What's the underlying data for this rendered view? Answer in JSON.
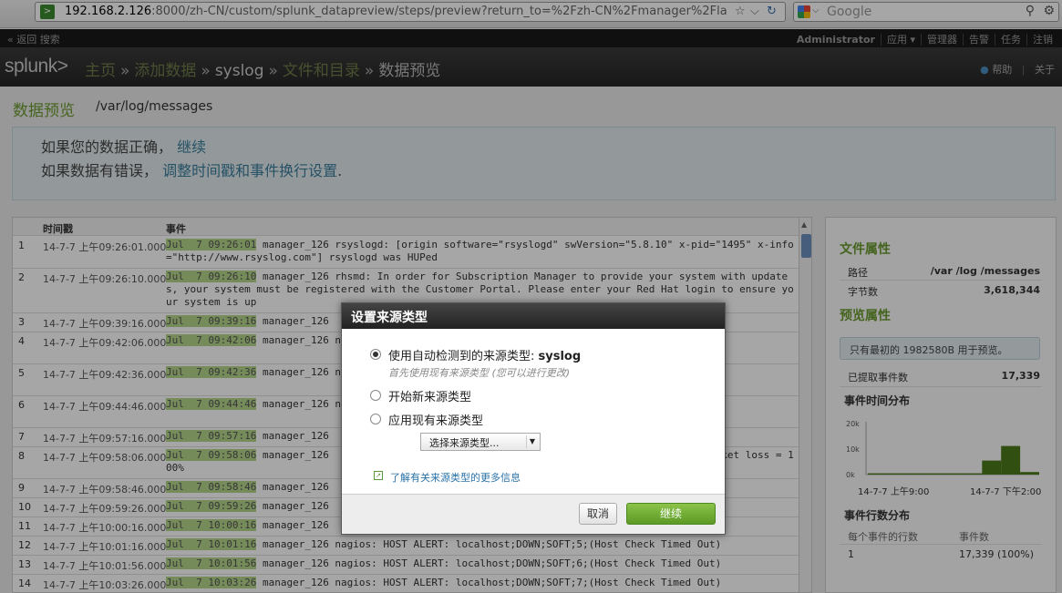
{
  "browser": {
    "url_host": "192.168.2.126",
    "url_rest": ":8000/zh-CN/custom/splunk_datapreview/steps/preview?return_to=%2Fzh-CN%2Fmanager%2Fla",
    "search_placeholder": "Google"
  },
  "topnav": {
    "back": "« 返回 搜索",
    "items": [
      "Administrator",
      "应用 ▾",
      "管理器",
      "告警",
      "任务",
      "注销"
    ]
  },
  "header": {
    "logo": "splunk>",
    "crumbs": [
      "主页",
      "添加数据",
      "syslog",
      "文件和目录"
    ],
    "current": "数据预览",
    "help": "帮助",
    "about": "关于"
  },
  "page": {
    "title": "数据预览",
    "path": "/var/log/messages",
    "info1_prefix": "如果您的数据正确，",
    "info1_link": "继续",
    "info2_prefix": "如果数据有错误，",
    "info2_link": "调整时间戳和事件换行设置",
    "info2_suffix": "."
  },
  "table": {
    "col_time": "时间戳",
    "col_event": "事件",
    "rows": [
      {
        "n": "1",
        "t": "14-7-7 上午09:26:01.000",
        "hl": "Jul  7 09:26:01",
        "text": " manager_126 rsyslogd: [origin software=\"rsyslogd\" swVersion=\"5.8.10\" x-pid=\"1495\" x-info=\"http://www.rsyslog.com\"] rsyslogd was HUPed"
      },
      {
        "n": "2",
        "t": "14-7-7 上午09:26:10.000",
        "hl": "Jul  7 09:26:10",
        "text": " manager_126 rhsmd: In order for Subscription Manager to provide your system with updates, your system must be registered with the Customer Portal. Please enter your Red Hat login to ensure your system is up"
      },
      {
        "n": "3",
        "t": "14-7-7 上午09:39:16.000",
        "hl": "Jul  7 09:39:16",
        "text": " manager_126"
      },
      {
        "n": "4",
        "t": "14-7-7 上午09:42:06.000",
        "hl": "Jul  7 09:42:06",
        "text": " manager_126 nagiosadmin;localhost;HTTP;C"
      },
      {
        "n": "5",
        "t": "14-7-7 上午09:42:36.000",
        "hl": "Jul  7 09:42:36",
        "text": " manager_126 nagiosadmin;localhost;Vsftp"
      },
      {
        "n": "6",
        "t": "14-7-7 上午09:44:46.000",
        "hl": "Jul  7 09:44:46",
        "text": " manager_126 nagiosadmin;localhost;SSH;C"
      },
      {
        "n": "7",
        "t": "14-7-7 上午09:57:16.000",
        "hl": "Jul  7 09:57:16",
        "text": " manager_126                                                    Out)"
      },
      {
        "n": "8",
        "t": "14-7-7 上午09:58:06.000",
        "hl": "Jul  7 09:58:06",
        "text": " manager_126                                                    RITICAL - Packet loss = 100%"
      },
      {
        "n": "9",
        "t": "14-7-7 上午09:58:46.000",
        "hl": "Jul  7 09:58:46",
        "text": " manager_126                                                    Out)"
      },
      {
        "n": "10",
        "t": "14-7-7 上午09:59:26.000",
        "hl": "Jul  7 09:59:26",
        "text": " manager_126                                                    Out)"
      },
      {
        "n": "11",
        "t": "14-7-7 上午10:00:16.000",
        "hl": "Jul  7 10:00:16",
        "text": " manager_126                                                    Out)"
      },
      {
        "n": "12",
        "t": "14-7-7 上午10:01:16.000",
        "hl": "Jul  7 10:01:16",
        "text": " manager_126 nagios: HOST ALERT: localhost;DOWN;SOFT;5;(Host Check Timed Out)"
      },
      {
        "n": "13",
        "t": "14-7-7 上午10:01:56.000",
        "hl": "Jul  7 10:01:56",
        "text": " manager_126 nagios: HOST ALERT: localhost;DOWN;SOFT;6;(Host Check Timed Out)"
      },
      {
        "n": "14",
        "t": "14-7-7 上午10:03:26.000",
        "hl": "Jul  7 10:03:26",
        "text": " manager_126 nagios: HOST ALERT: localhost;DOWN;SOFT;7;(Host Check Timed Out)"
      }
    ]
  },
  "sidebar": {
    "file_props": "文件属性",
    "path_k": "路径",
    "path_v": "/var /log /messages",
    "bytes_k": "字节数",
    "bytes_v": "3,618,344",
    "preview_props": "预览属性",
    "notice": "只有最初的 1982580B 用于预览。",
    "extracted_k": "已提取事件数",
    "extracted_v": "17,339",
    "time_dist": "事件时间分布",
    "y_ticks": [
      "20k",
      "10k",
      "0k"
    ],
    "x_ticks": [
      "14-7-7 上午9:00",
      "14-7-7 下午2:00"
    ],
    "line_dist": "事件行数分布",
    "lines_per_event_k": "每个事件的行数",
    "event_count_k": "事件数",
    "lines_row_k": "1",
    "lines_row_v": "17,339 (100%)"
  },
  "chart_data": {
    "type": "bar",
    "ylim": [
      0,
      20000
    ],
    "values": [
      500,
      500,
      500,
      500,
      500,
      500,
      5500,
      11200,
      1000
    ]
  },
  "dialog": {
    "title": "设置来源类型",
    "opt1_prefix": "使用自动检测到的来源类型: ",
    "opt1_value": "syslog",
    "opt1_hint": "首先使用现有来源类型 (您可以进行更改)",
    "opt2": "开始新来源类型",
    "opt3": "应用现有来源类型",
    "select_label": "选择来源类型...",
    "more_info": "了解有关来源类型的更多信息",
    "cancel": "取消",
    "continue": "继续"
  },
  "colors": {
    "accent": "#6a9a2e",
    "highlight": "#b6d68a",
    "link": "#3a7d9b"
  }
}
